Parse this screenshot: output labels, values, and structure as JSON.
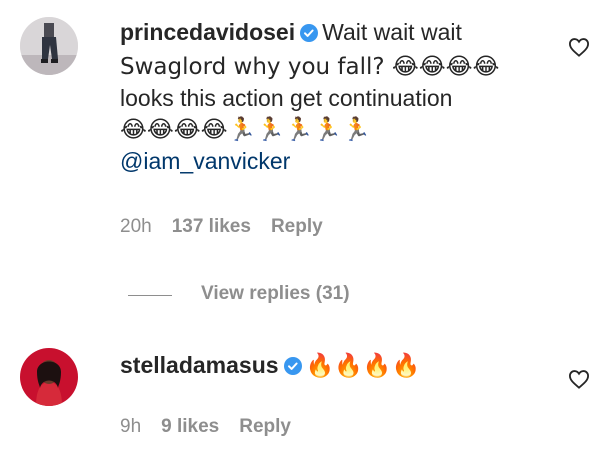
{
  "comments": [
    {
      "username": "princedavidosei",
      "text_line1": "Wait wait wait",
      "text_line2": "Swaglord why you fall? 😂😂😂😂",
      "text_line3": "looks this action get continuation",
      "text_line4": "😂😂😂😂🏃🏃🏃🏃🏃",
      "mention": "@iam_vanvicker",
      "time": "20h",
      "likes": "137 likes",
      "reply": "Reply",
      "view_replies": "View replies (31)"
    },
    {
      "username": "stelladamasus",
      "text": "🔥🔥🔥🔥",
      "time": "9h",
      "likes": "9 likes",
      "reply": "Reply"
    }
  ],
  "colors": {
    "verified": "#3897f0",
    "mention": "#00376b",
    "meta": "#8e8e8e"
  }
}
